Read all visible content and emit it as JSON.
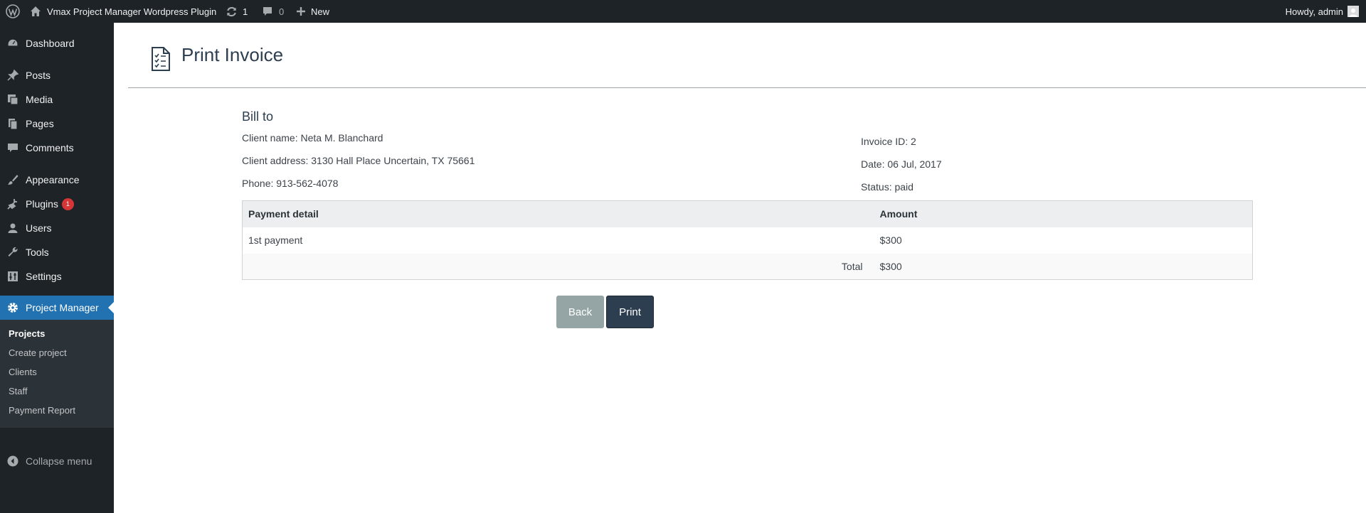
{
  "adminbar": {
    "site_name": "Vmax Project Manager Wordpress Plugin",
    "updates_count": "1",
    "comments_count": "0",
    "new_label": "New",
    "howdy": "Howdy, admin"
  },
  "sidebar": {
    "items": [
      {
        "label": "Dashboard",
        "icon": "dashboard-icon"
      },
      {
        "label": "Posts",
        "icon": "pin-icon"
      },
      {
        "label": "Media",
        "icon": "media-icon"
      },
      {
        "label": "Pages",
        "icon": "pages-icon"
      },
      {
        "label": "Comments",
        "icon": "comment-icon"
      },
      {
        "label": "Appearance",
        "icon": "brush-icon"
      },
      {
        "label": "Plugins",
        "icon": "plugin-icon",
        "badge": "1"
      },
      {
        "label": "Users",
        "icon": "user-icon"
      },
      {
        "label": "Tools",
        "icon": "wrench-icon"
      },
      {
        "label": "Settings",
        "icon": "settings-icon"
      },
      {
        "label": "Project Manager",
        "icon": "gear-icon"
      }
    ],
    "submenu": [
      "Projects",
      "Create project",
      "Clients",
      "Staff",
      "Payment Report"
    ],
    "collapse_label": "Collapse menu"
  },
  "page": {
    "title": "Print Invoice",
    "bill_to": "Bill to",
    "client_name": "Client name: Neta M. Blanchard",
    "client_address": "Client address: 3130 Hall Place Uncertain, TX 75661",
    "phone": "Phone: 913-562-4078",
    "invoice_id": "Invoice ID:  2",
    "date": "Date: 06 Jul, 2017",
    "status": "Status: paid"
  },
  "table": {
    "headers": [
      "Payment detail",
      "Amount"
    ],
    "rows": [
      {
        "detail": "1st payment",
        "amount": "$300"
      }
    ],
    "total_label": "Total",
    "total_amount": "$300"
  },
  "buttons": {
    "back": "Back",
    "print": "Print"
  },
  "colors": {
    "sidebar_bg": "#1d2327",
    "accent": "#2271b1",
    "back_button": "#95a5a6",
    "print_button": "#2c3e50"
  }
}
